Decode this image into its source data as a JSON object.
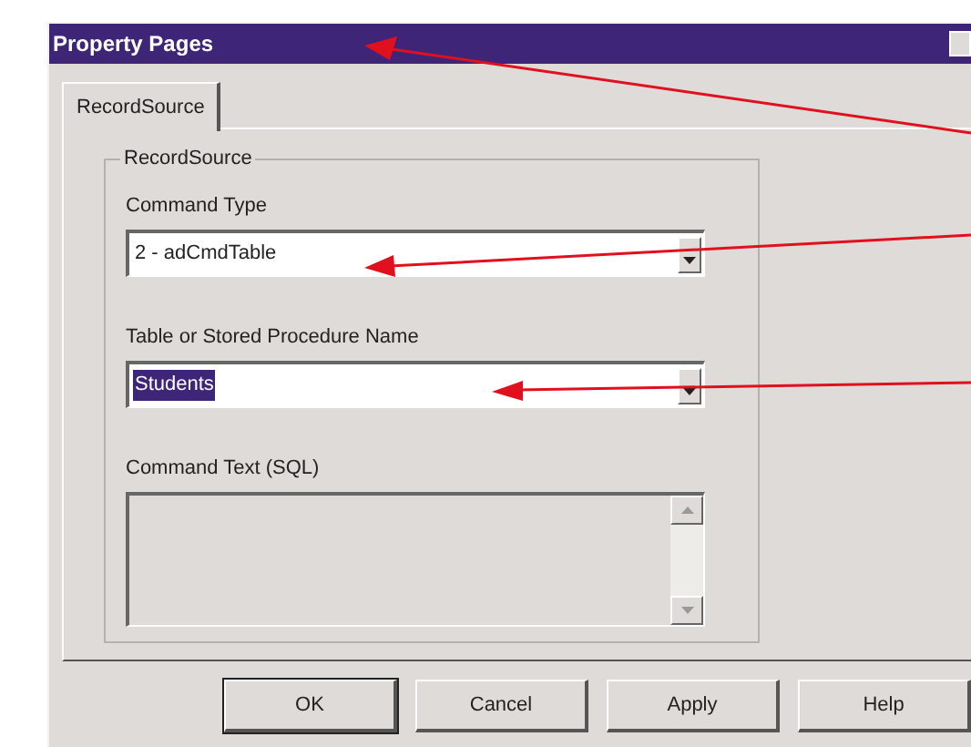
{
  "window": {
    "title": "Property Pages"
  },
  "tabs": [
    {
      "label": "RecordSource",
      "selected": true
    }
  ],
  "group": {
    "label": "RecordSource",
    "fields": [
      {
        "kind": "combo",
        "label": "Command Type",
        "value": "2 - adCmdTable",
        "text_selected": false,
        "disabled": false
      },
      {
        "kind": "combo",
        "label": "Table or Stored Procedure Name",
        "value": "Students",
        "text_selected": true,
        "disabled": false
      },
      {
        "kind": "memo",
        "label": "Command Text (SQL)",
        "disabled": true
      }
    ]
  },
  "buttons": [
    {
      "label": "OK",
      "default": true
    },
    {
      "label": "Cancel",
      "default": false
    },
    {
      "label": "Apply",
      "default": false
    },
    {
      "label": "Help",
      "default": false
    }
  ]
}
